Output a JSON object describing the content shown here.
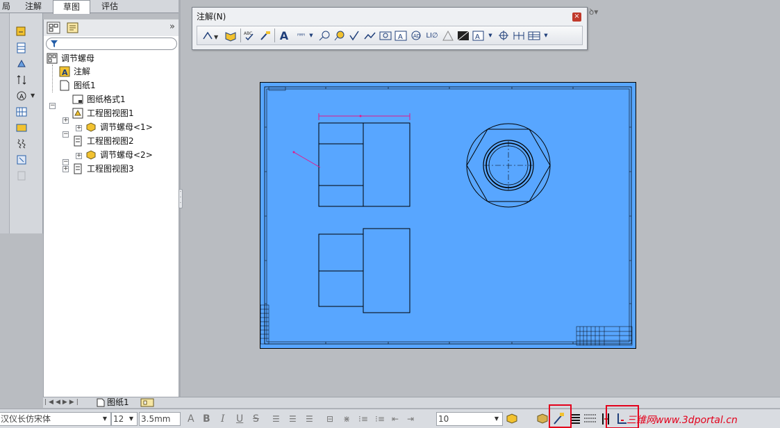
{
  "tabs": [
    {
      "label": "局"
    },
    {
      "label": "注解"
    },
    {
      "label": "草图"
    },
    {
      "label": "评估"
    }
  ],
  "tree": {
    "root": "调节螺母",
    "annotations": "注解",
    "sheet": "图纸1",
    "sheet_format": "图纸格式1",
    "view1": "工程图视图1",
    "part1": "调节螺母<1>",
    "view2": "工程图视图2",
    "part2": "调节螺母<2>",
    "view3": "工程图视图3"
  },
  "annotation_toolbar": {
    "title": "注解(N)",
    "close": "×"
  },
  "sheet_tab": "图纸1",
  "status": {
    "font": "汉仪长仿宋体",
    "font_size": "12",
    "height": "3.5mm",
    "layer_value": "10"
  },
  "watermark": "三维网www.3dportal.cn",
  "colors": {
    "sheet_fill": "#58a6ff",
    "highlight": "#e3001b"
  }
}
